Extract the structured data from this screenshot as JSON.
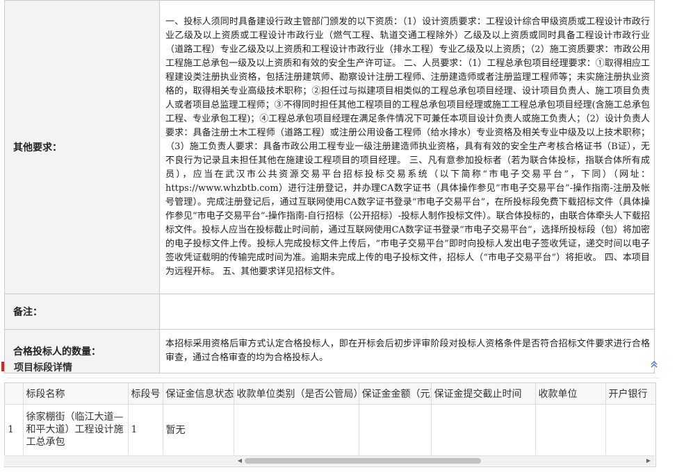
{
  "info": {
    "other_label": "其他要求：",
    "other_text": " 一、投标人须同时具备建设行政主管部门颁发的以下资质：（1）设计资质要求：工程设计综合甲级资质或工程设计市政行业乙级及以上资质或工程设计市政行业（燃气工程、轨道交通工程除外）乙级及以上资质或同时具备工程设计市政行业（道路工程）专业乙级及以上资质和工程设计市政行业（排水工程）专业乙级及以上资质；（2）施工资质要求：市政公用工程施工总承包一级及以上资质和有效的安全生产许可证。 二、人员要求：（1）工程总承包项目经理要求：①取得相应工程建设类注册执业资格，包括注册建筑师、勘察设计注册工程师、注册建造师或者注册监理工程师等；未实施注册执业资格的，取得相关专业高级技术职称；②担任过与拟建项目相类似的工程总承包项目经理、设计项目负责人、施工项目负责人或者项目总监理工程师；③不得同时担任其他工程项目的工程总承包项目经理或施工工程总承包项目经理(含施工总承包工程、专业承包工程)；④工程总承包项目经理在满足条件情况下可兼任本项目设计负责人或施工负责人；（2）设计负责人要求：具备注册土木工程师（道路工程）或注册公用设备工程师（给水排水）专业资格及相关专业中级及以上技术职称；（3）施工负责人要求：具备市政公用工程专业一级注册建造师执业资格，具有有效的安全生产考核合格证书（B证），无不良行为记录且未担任其他在施建设工程项目的项目经理。 三、凡有意参加投标者（若为联合体投标，指联合体所有成员），应当在武汉市公共资源交易平台招标投标交易系统（以下简称“市电子交易平台”，下同）（网址：https://www.whzbtb.com）进行注册登记，并办理CA数字证书（具体操作参见“市电子交易平台”-操作指南-注册及帐号管理）。完成注册登记后，通过互联网使用CA数字证书登录“市电子交易平台”，在所投标段免费下载招标文件（具体操作参见“市电子交易平台”-操作指南-自行招标（公开招标）-投标人制作投标文件）。联合体投标的，由联合体牵头人下载招标文件。投标人应当在投标截止时间前，通过互联网使用CA数字证书登录“市电子交易平台”，选择所投标段（包）将加密的电子投标文件上传。投标人完成投标文件上传后，“市电子交易平台”即时向投标人发出电子签收凭证，递交时间以电子签收凭证载明的传输完成时间为准。逾期未完成上传的电子投标文件，招标人（“市电子交易平台”）将拒收。 四、本项目为远程开标。 五、其他要求详见招标文件。",
    "note_label": "备注：",
    "note_text": "",
    "qual_label": "合格投标人的数量：",
    "qual_text": " 本招标采用资格后审方式认定合格投标人，即在开标会后初步评审阶段对投标人资格条件是否符合招标文件要求进行合格审查，通过合格审查的均为合格投标人。"
  },
  "section": {
    "title": "项目标段详情",
    "collapse_icon": "chevron-up-icon"
  },
  "grid": {
    "headers": [
      "",
      "标段名称",
      "标段号",
      "保证金信息状态",
      "收款单位类别（是否公管局）",
      "保证金金额（元）",
      "保证金提交截止时间",
      "收款单位",
      "开户银行"
    ],
    "rows": [
      [
        "1",
        "徐家棚街（临江大道—和平大道）工程设计施工总承包",
        "1",
        "暂无",
        "",
        "",
        "",
        "",
        ""
      ]
    ]
  }
}
